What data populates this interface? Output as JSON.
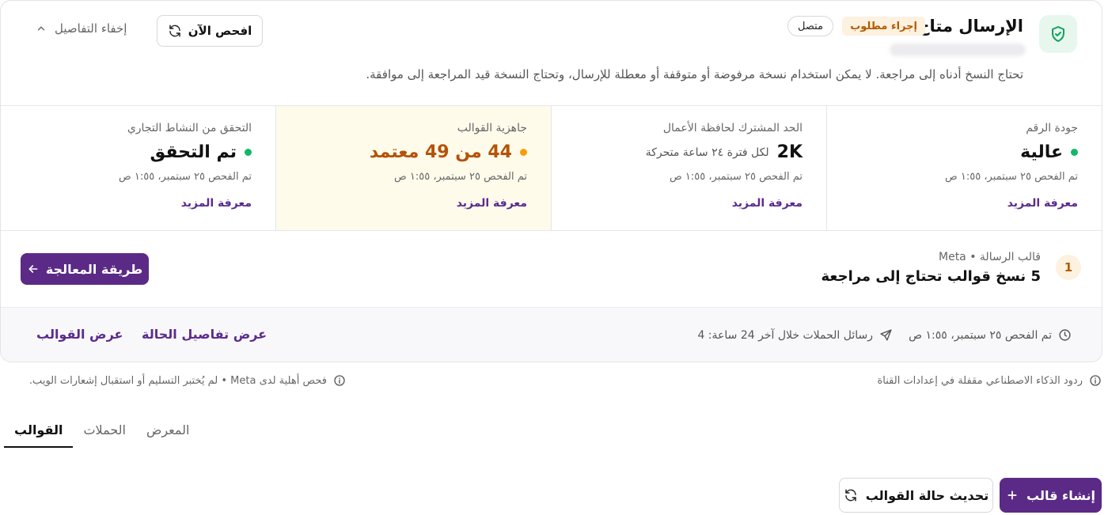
{
  "header": {
    "title": "الإرسال متاح",
    "action_badge": "إجراء مطلوب",
    "connected_badge": "متصل",
    "description": "تحتاج النسخ أدناه إلى مراجعة. لا يمكن استخدام نسخة مرفوضة أو متوقفة أو معطلة للإرسال، وتحتاج النسخة قيد المراجعة إلى موافقة.",
    "check_now_label": "افحص الآن",
    "hide_details_label": "إخفاء التفاصيل",
    "icons": {
      "status": "shield-check-icon",
      "refresh": "refresh-icon",
      "toggle": "chevron-up-icon"
    }
  },
  "stats": [
    {
      "label": "جودة الرقم",
      "value": "عالية",
      "sub": "",
      "status": "green",
      "time": "تم الفحص ٢٥ سبتمبر، ١:٥٥ ص",
      "link": "معرفة المزيد"
    },
    {
      "label": "الحد المشترك لحافظة الأعمال",
      "value": "2K",
      "sub": "لكل فترة ٢٤ ساعة متحركة",
      "status": "none",
      "time": "تم الفحص ٢٥ سبتمبر، ١:٥٥ ص",
      "link": "معرفة المزيد"
    },
    {
      "label": "جاهزية القوالب",
      "value": "44 من 49 معتمد",
      "sub": "",
      "status": "orange",
      "time": "تم الفحص ٢٥ سبتمبر، ١:٥٥ ص",
      "link": "معرفة المزيد"
    },
    {
      "label": "التحقق من النشاط التجاري",
      "value": "تم التحقق",
      "sub": "",
      "status": "green",
      "time": "تم الفحص ٢٥ سبتمبر، ١:٥٥ ص",
      "link": "معرفة المزيد"
    }
  ],
  "task": {
    "number": "1",
    "kicker": "قالب الرسالة • Meta",
    "title": "5 نسخ قوالب تحتاج إلى مراجعة",
    "button_label": "طريقة المعالجة"
  },
  "footer": {
    "checked_time": "تم الفحص ٢٥ سبتمبر، ١:٥٥ ص",
    "campaigns_text": "رسائل الحملات خلال آخر 24 ساعة: 4",
    "view_status_link": "عرض تفاصيل الحالة",
    "view_templates_link": "عرض القوالب"
  },
  "notes": {
    "ai_replies": "ردود الذكاء الاصطناعي مقفلة في إعدادات القناة",
    "meta_check": "فحص أهلية لدى Meta • لم يُختبر التسليم أو استقبال إشعارات الويب."
  },
  "tabs": [
    {
      "label": "القوالب",
      "active": true
    },
    {
      "label": "الحملات",
      "active": false
    },
    {
      "label": "المعرض",
      "active": false
    }
  ],
  "actions": {
    "create_template": "إنشاء قالب",
    "refresh_templates": "تحديث حالة القوالب"
  },
  "colors": {
    "primary": "#5b2a86",
    "link": "#5b2b8f",
    "success": "#12b76a",
    "warning": "#f59e0b",
    "warning_bg": "#fffbeb",
    "badge_bg": "#fdf1df",
    "badge_text": "#b25b00"
  }
}
